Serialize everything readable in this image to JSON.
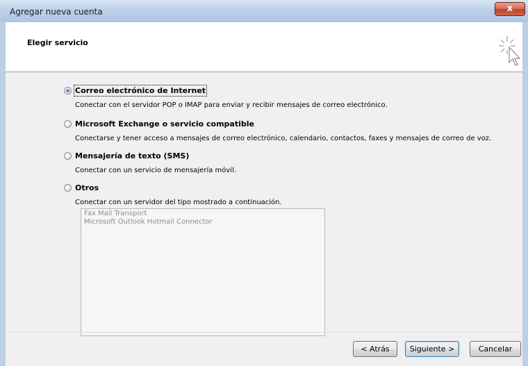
{
  "window": {
    "title": "Agregar nueva cuenta",
    "close_label": "x"
  },
  "header": {
    "title": "Elegir servicio",
    "icon": "cursor-click-icon"
  },
  "options": [
    {
      "label": "Correo electrónico de Internet",
      "description": "Conectar con el servidor POP o IMAP para enviar y recibir mensajes de correo electrónico.",
      "selected": true
    },
    {
      "label": "Microsoft Exchange o servicio compatible",
      "description": "Conectarse y tener acceso a mensajes de correo electrónico, calendario, contactos, faxes y mensajes de correo de voz.",
      "selected": false
    },
    {
      "label": "Mensajería de texto (SMS)",
      "description": "Conectar con un servicio de mensajería móvil.",
      "selected": false
    },
    {
      "label": "Otros",
      "description": "Conectar con un servidor del tipo mostrado a continuación.",
      "selected": false
    }
  ],
  "other_services": [
    "Fax Mail Transport",
    "Microsoft Outlook Hotmail Connector"
  ],
  "buttons": {
    "back": "< Atrás",
    "next": "Siguiente >",
    "cancel": "Cancelar"
  },
  "colors": {
    "frame": "#b9cde6",
    "close": "#c0432b",
    "default_button_border": "#3c7fb1"
  }
}
